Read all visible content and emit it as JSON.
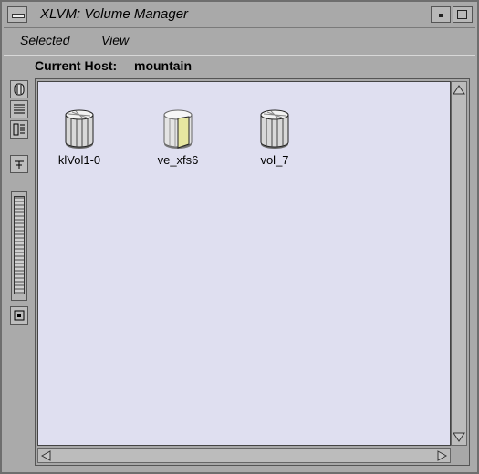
{
  "window": {
    "title": "XLVM: Volume Manager"
  },
  "menu": {
    "items": [
      "Selected",
      "View"
    ]
  },
  "host": {
    "label": "Current Host:",
    "value": "mountain"
  },
  "volumes": [
    {
      "name": "klVol1-0",
      "state": "normal"
    },
    {
      "name": "ve_xfs6",
      "state": "open"
    },
    {
      "name": "vol_7",
      "state": "normal"
    }
  ],
  "icons": {
    "toolbar": [
      "volume-view-icon",
      "list-view-icon",
      "detail-view-icon",
      "hierarchy-icon",
      "zoom-slider",
      "fit-icon"
    ]
  },
  "colors": {
    "canvas": "#dfdff0",
    "chrome": "#aaaaaa"
  }
}
